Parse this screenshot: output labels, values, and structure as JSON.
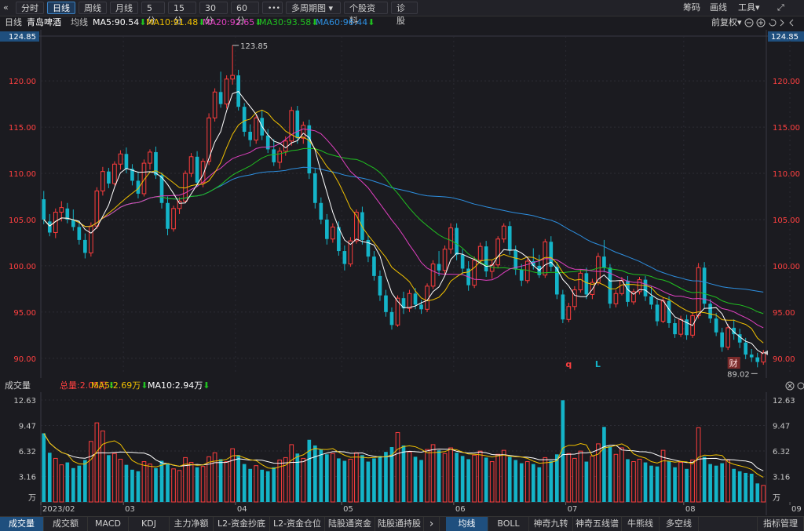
{
  "toolbar": {
    "back_glyph": "«",
    "periods": [
      "分时",
      "日线",
      "周线",
      "月线",
      "5分",
      "15分",
      "30分",
      "60分"
    ],
    "more_glyph": "•••",
    "multi_period": "多周期图",
    "multi_arrow": "▾",
    "stock_info": "个股资料",
    "diagnosis": "诊股",
    "right_items": [
      "筹码",
      "画线",
      "工具"
    ],
    "tools_arrow": "▾",
    "expand_glyph": "⤢"
  },
  "info": {
    "period": "日线",
    "stock": "青岛啤酒",
    "ma_label": "均线",
    "ma5": "MA5:90.54",
    "ma10": "MA10:91.48",
    "ma20": "MA20:92.65",
    "ma30": "MA30:93.58",
    "ma60": "MA60:96.44",
    "down_glyph": "⬇",
    "adjust": "前复权",
    "adjust_arrow": "▾",
    "colors": {
      "ma5": "#ffffff",
      "ma10": "#f0c000",
      "ma20": "#e040c0",
      "ma30": "#20c020",
      "ma60": "#2d8fe0"
    }
  },
  "volume_info": {
    "label": "成交量",
    "total": "总量:2.05万",
    "ma5": "MA5:2.69万",
    "ma10": "MA10:2.94万",
    "down_glyph": "⬇"
  },
  "chart_data": {
    "type": "candlestick",
    "ylim": [
      88.2,
      124.85
    ],
    "top_value_label": "124.85",
    "price_ticks": [
      "120.00",
      "115.00",
      "110.00",
      "105.00",
      "100.00",
      "95.00",
      "90.00"
    ],
    "high_annotation": "123.85",
    "low_annotation": "89.02",
    "volume_ticks": [
      "12.63",
      "9.47",
      "6.32",
      "3.16"
    ],
    "volume_unit": "万",
    "vol_ylim": [
      0,
      12.63
    ],
    "x_labels": [
      "2023/02",
      "03",
      "04",
      "05",
      "06",
      "07",
      "08",
      "09"
    ],
    "event_markers": [
      "q",
      "L",
      "财"
    ],
    "series_names": [
      "MA5",
      "MA10",
      "MA20",
      "MA30",
      "MA60"
    ],
    "up_color": "#ff3d3d",
    "down_color": "#14b4c8",
    "candles": [
      [
        107.2,
        108.1,
        104.5,
        105.0,
        8.5
      ],
      [
        104.8,
        105.6,
        103.2,
        103.6,
        6.1
      ],
      [
        103.6,
        106.2,
        103.0,
        105.8,
        5.4
      ],
      [
        105.8,
        107.0,
        104.8,
        106.3,
        4.6
      ],
      [
        106.2,
        106.8,
        104.6,
        105.0,
        4.9
      ],
      [
        105.0,
        106.1,
        103.8,
        104.2,
        4.2
      ],
      [
        104.2,
        104.9,
        102.3,
        102.8,
        4.5
      ],
      [
        102.8,
        103.5,
        100.8,
        101.4,
        5.2
      ],
      [
        101.4,
        104.7,
        101.0,
        104.3,
        7.5
      ],
      [
        104.3,
        108.5,
        104.0,
        108.1,
        9.8
      ],
      [
        108.1,
        110.7,
        107.6,
        110.2,
        8.8
      ],
      [
        110.2,
        110.6,
        108.4,
        108.9,
        5.8
      ],
      [
        108.9,
        111.3,
        108.7,
        111.0,
        6.0
      ],
      [
        111.0,
        112.5,
        110.4,
        112.1,
        5.3
      ],
      [
        112.1,
        112.8,
        110.0,
        110.5,
        4.6
      ],
      [
        110.5,
        111.0,
        108.7,
        109.2,
        4.0
      ],
      [
        109.2,
        110.2,
        107.3,
        107.8,
        3.8
      ],
      [
        107.8,
        111.5,
        107.5,
        111.1,
        5.0
      ],
      [
        111.1,
        112.6,
        110.4,
        112.3,
        4.7
      ],
      [
        112.3,
        112.9,
        109.4,
        109.8,
        4.2
      ],
      [
        109.8,
        110.1,
        106.2,
        106.8,
        5.1
      ],
      [
        106.8,
        107.5,
        103.3,
        104.0,
        4.8
      ],
      [
        104.0,
        106.5,
        103.7,
        106.2,
        4.1
      ],
      [
        106.2,
        107.4,
        105.6,
        107.0,
        3.9
      ],
      [
        107.0,
        110.3,
        106.8,
        110.0,
        5.5
      ],
      [
        110.0,
        112.2,
        109.6,
        111.8,
        4.9
      ],
      [
        111.8,
        112.4,
        108.6,
        109.0,
        4.3
      ],
      [
        109.0,
        111.6,
        108.5,
        111.3,
        4.4
      ],
      [
        111.3,
        116.5,
        110.9,
        116.0,
        5.6
      ],
      [
        116.0,
        119.2,
        115.6,
        118.8,
        6.1
      ],
      [
        118.8,
        121.0,
        117.1,
        117.5,
        5.3
      ],
      [
        117.5,
        120.6,
        117.0,
        120.2,
        5.0
      ],
      [
        120.2,
        123.85,
        119.6,
        120.6,
        6.6
      ],
      [
        120.6,
        121.2,
        116.8,
        117.2,
        5.8
      ],
      [
        117.2,
        117.6,
        114.0,
        114.5,
        4.7
      ],
      [
        114.5,
        115.3,
        112.9,
        113.6,
        4.1
      ],
      [
        113.6,
        116.3,
        113.2,
        116.0,
        4.5
      ],
      [
        116.0,
        116.8,
        113.6,
        114.1,
        4.0
      ],
      [
        114.1,
        114.8,
        112.2,
        112.6,
        3.8
      ],
      [
        112.6,
        113.7,
        110.8,
        111.2,
        4.3
      ],
      [
        111.2,
        112.8,
        110.5,
        112.4,
        5.2
      ],
      [
        112.4,
        114.0,
        111.9,
        113.5,
        5.5
      ],
      [
        113.5,
        117.2,
        113.0,
        116.8,
        7.1
      ],
      [
        116.8,
        117.3,
        113.2,
        113.8,
        6.0
      ],
      [
        113.8,
        115.6,
        113.2,
        115.2,
        5.4
      ],
      [
        115.2,
        115.8,
        109.4,
        110.0,
        7.7
      ],
      [
        110.0,
        110.6,
        106.2,
        106.8,
        7.0
      ],
      [
        106.8,
        107.4,
        104.5,
        105.0,
        6.5
      ],
      [
        105.0,
        105.6,
        102.3,
        102.9,
        5.9
      ],
      [
        102.9,
        104.6,
        102.5,
        104.2,
        6.0
      ],
      [
        104.2,
        104.8,
        101.1,
        101.6,
        5.4
      ],
      [
        101.6,
        102.2,
        99.5,
        100.2,
        5.1
      ],
      [
        100.2,
        103.1,
        99.9,
        102.7,
        5.3
      ],
      [
        102.7,
        106.1,
        102.4,
        105.8,
        6.1
      ],
      [
        105.8,
        106.4,
        102.3,
        102.8,
        5.8
      ],
      [
        102.8,
        103.3,
        100.4,
        101.0,
        5.0
      ],
      [
        101.0,
        101.6,
        98.4,
        98.9,
        5.4
      ],
      [
        98.9,
        99.5,
        96.2,
        96.8,
        5.7
      ],
      [
        96.8,
        97.4,
        94.5,
        95.0,
        6.2
      ],
      [
        95.0,
        95.5,
        93.1,
        93.6,
        6.8
      ],
      [
        93.6,
        96.8,
        93.4,
        96.5,
        8.6
      ],
      [
        96.5,
        97.2,
        94.8,
        95.4,
        7.0
      ],
      [
        95.4,
        97.4,
        95.0,
        97.0,
        6.2
      ],
      [
        97.0,
        97.6,
        95.3,
        95.8,
        5.6
      ],
      [
        95.8,
        96.3,
        94.8,
        95.3,
        5.2
      ],
      [
        95.3,
        98.1,
        95.0,
        97.8,
        6.5
      ],
      [
        97.8,
        100.6,
        97.5,
        100.2,
        7.1
      ],
      [
        100.2,
        101.6,
        98.9,
        99.5,
        6.4
      ],
      [
        99.5,
        102.2,
        99.1,
        101.8,
        6.0
      ],
      [
        101.8,
        104.6,
        101.3,
        104.1,
        6.7
      ],
      [
        104.1,
        104.6,
        100.6,
        101.2,
        6.1
      ],
      [
        101.2,
        101.8,
        99.1,
        99.7,
        5.7
      ],
      [
        99.7,
        100.5,
        97.3,
        97.9,
        5.3
      ],
      [
        97.9,
        101.0,
        97.6,
        100.6,
        5.8
      ],
      [
        100.6,
        102.5,
        100.2,
        102.1,
        6.3
      ],
      [
        102.1,
        102.7,
        98.8,
        99.4,
        5.5
      ],
      [
        99.4,
        100.6,
        98.6,
        100.1,
        5.0
      ],
      [
        100.1,
        103.2,
        99.8,
        102.9,
        5.9
      ],
      [
        102.9,
        104.6,
        102.5,
        104.3,
        6.4
      ],
      [
        104.3,
        104.8,
        101.2,
        101.7,
        5.6
      ],
      [
        101.7,
        102.2,
        99.0,
        99.6,
        5.2
      ],
      [
        99.6,
        100.2,
        97.8,
        98.4,
        4.8
      ],
      [
        98.4,
        100.8,
        98.1,
        100.5,
        5.0
      ],
      [
        100.5,
        101.9,
        99.6,
        100.0,
        4.7
      ],
      [
        100.0,
        101.2,
        98.7,
        99.0,
        4.3
      ],
      [
        99.0,
        102.9,
        98.7,
        102.6,
        5.5
      ],
      [
        102.6,
        103.2,
        99.4,
        99.9,
        5.1
      ],
      [
        99.9,
        100.4,
        96.4,
        96.9,
        5.9
      ],
      [
        96.9,
        97.4,
        93.8,
        94.2,
        12.6
      ],
      [
        94.2,
        96.0,
        93.9,
        95.6,
        6.0
      ],
      [
        95.6,
        97.8,
        95.2,
        97.4,
        5.4
      ],
      [
        97.4,
        99.6,
        97.1,
        99.2,
        6.3
      ],
      [
        99.2,
        99.8,
        96.4,
        96.9,
        5.0
      ],
      [
        96.9,
        98.6,
        96.4,
        98.2,
        5.7
      ],
      [
        98.2,
        101.4,
        97.9,
        101.0,
        7.2
      ],
      [
        101.0,
        102.8,
        99.3,
        99.8,
        9.3
      ],
      [
        99.8,
        100.2,
        95.4,
        95.9,
        6.9
      ],
      [
        95.9,
        97.4,
        95.5,
        97.0,
        5.9
      ],
      [
        97.0,
        98.8,
        96.8,
        98.4,
        6.7
      ],
      [
        98.4,
        98.9,
        95.6,
        96.1,
        5.3
      ],
      [
        96.1,
        97.5,
        95.8,
        97.2,
        5.0
      ],
      [
        97.2,
        98.8,
        96.9,
        98.5,
        5.3
      ],
      [
        98.5,
        98.9,
        96.2,
        96.7,
        4.9
      ],
      [
        96.7,
        97.8,
        95.3,
        95.8,
        4.5
      ],
      [
        95.8,
        96.3,
        93.5,
        94.0,
        4.4
      ],
      [
        94.0,
        96.6,
        93.8,
        96.2,
        6.4
      ],
      [
        96.2,
        96.7,
        93.3,
        93.8,
        5.1
      ],
      [
        93.8,
        94.3,
        92.2,
        92.6,
        4.3
      ],
      [
        92.6,
        94.6,
        92.3,
        94.2,
        4.9
      ],
      [
        94.2,
        94.7,
        92.0,
        92.5,
        4.1
      ],
      [
        92.5,
        95.0,
        92.2,
        94.6,
        5.2
      ],
      [
        94.6,
        100.3,
        94.3,
        99.8,
        9.2
      ],
      [
        99.8,
        100.4,
        95.4,
        95.9,
        5.6
      ],
      [
        95.9,
        96.4,
        93.8,
        94.3,
        4.7
      ],
      [
        94.3,
        94.9,
        92.4,
        92.8,
        4.5
      ],
      [
        92.8,
        93.3,
        90.7,
        91.2,
        4.8
      ],
      [
        91.2,
        93.7,
        90.9,
        93.3,
        5.2
      ],
      [
        93.3,
        94.2,
        92.0,
        92.6,
        4.1
      ],
      [
        92.6,
        93.2,
        91.1,
        91.7,
        3.8
      ],
      [
        91.7,
        92.2,
        89.9,
        90.4,
        3.6
      ],
      [
        90.4,
        91.0,
        89.6,
        90.1,
        3.5
      ],
      [
        90.1,
        90.6,
        89.02,
        89.6,
        2.3
      ],
      [
        89.6,
        90.9,
        89.3,
        90.6,
        2.05
      ]
    ]
  },
  "bottom_tabs": [
    "成交量",
    "成交额",
    "MACD",
    "KDJ",
    "主力净额",
    "L2-资金抄底",
    "L2-资金仓位",
    "陆股通资金",
    "陆股通持股"
  ],
  "bottom_nav": "›",
  "bottom_tabs_right": [
    "均线",
    "BOLL",
    "神奇九转",
    "神奇五线谱",
    "牛熊线",
    "多空线"
  ],
  "bottom_right_end": "指标管理"
}
